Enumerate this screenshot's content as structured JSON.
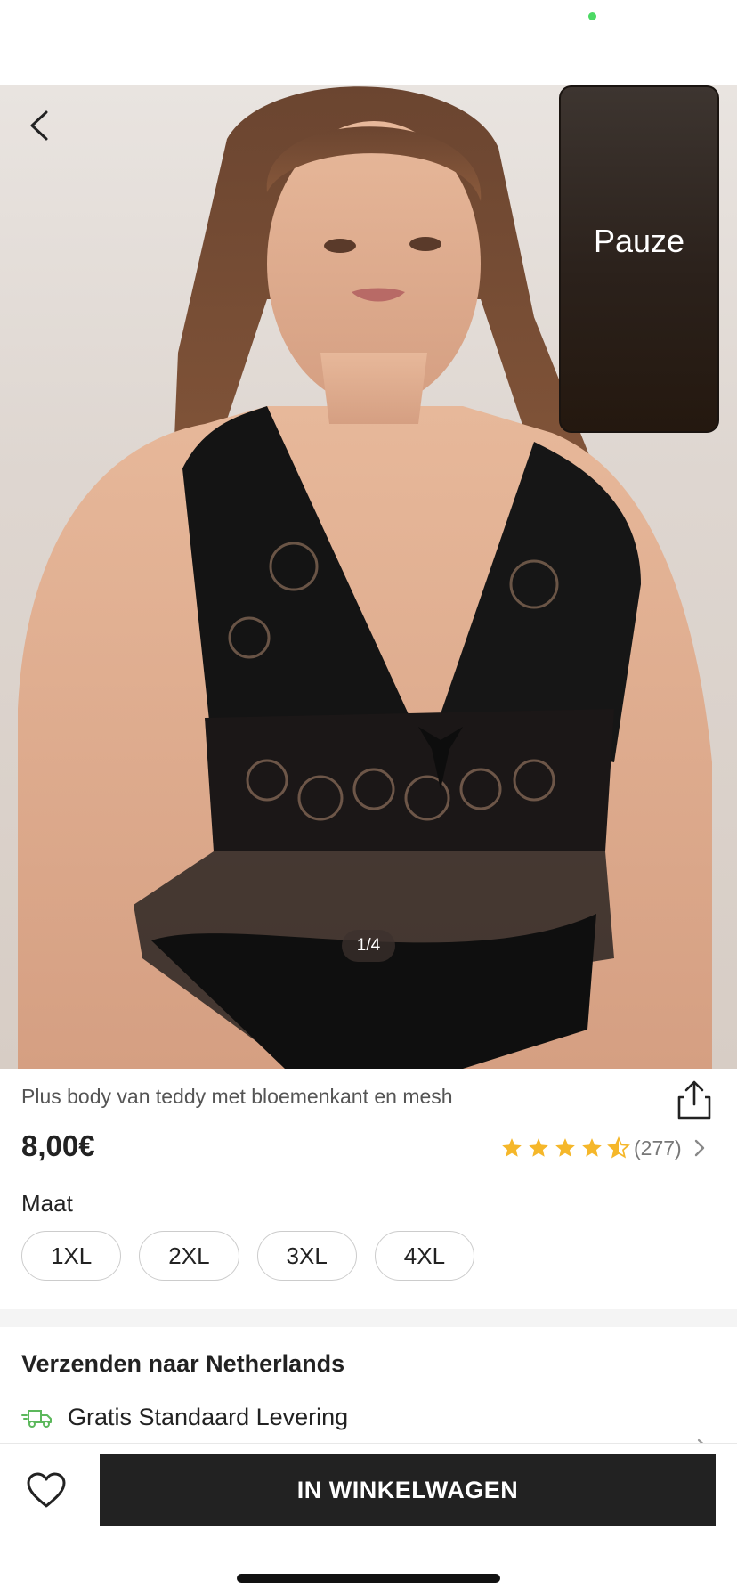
{
  "status": {
    "indicator_color": "#4cd964"
  },
  "gallery": {
    "pip_label": "Pauze",
    "counter": "1/4",
    "back_icon": "chevron-left-icon"
  },
  "product": {
    "title": "Plus body van teddy met bloemenkant en mesh",
    "price": "8,00€",
    "rating": {
      "stars": 4.5,
      "max": 5,
      "count": "(277)",
      "star_color": "#f5b72a"
    },
    "size_label": "Maat",
    "sizes": [
      "1XL",
      "2XL",
      "3XL",
      "4XL"
    ]
  },
  "shipping": {
    "title": "Verzenden naar Netherlands",
    "option": "Gratis Standaard Levering",
    "truck_color": "#5cb85c"
  },
  "bottom": {
    "add_to_cart": "IN WINKELWAGEN"
  }
}
